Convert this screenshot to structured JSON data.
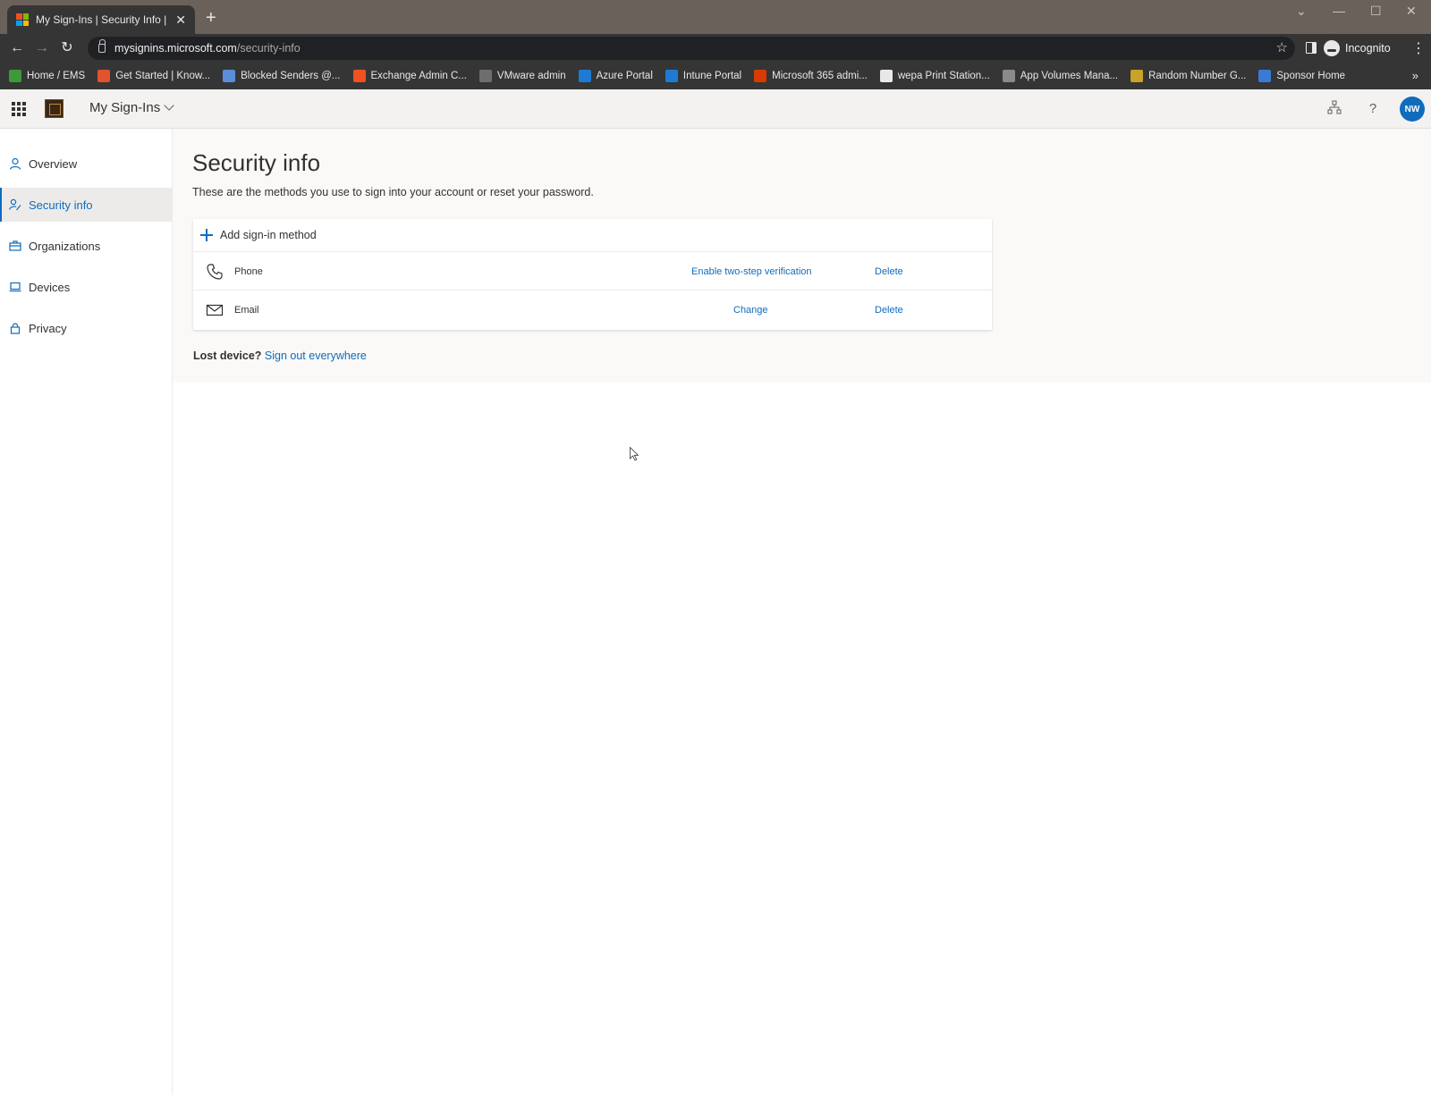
{
  "browser": {
    "tab_title": "My Sign-Ins | Security Info | Micr",
    "url_host": "mysignins.microsoft.com",
    "url_path": "/security-info",
    "profile_label": "Incognito",
    "bookmarks": [
      {
        "label": "Home / EMS",
        "color": "#3c9a3c"
      },
      {
        "label": "Get Started | Know...",
        "color": "#e0532e"
      },
      {
        "label": "Blocked Senders @...",
        "color": "#5b8dd8"
      },
      {
        "label": "Exchange Admin C...",
        "color": "#f25022"
      },
      {
        "label": "VMware admin",
        "color": "#6e6e6e"
      },
      {
        "label": "Azure Portal",
        "color": "#1e7bd3"
      },
      {
        "label": "Intune Portal",
        "color": "#1e7bd3"
      },
      {
        "label": "Microsoft 365 admi...",
        "color": "#d83b01"
      },
      {
        "label": "wepa Print Station...",
        "color": "#e8e8e8"
      },
      {
        "label": "App Volumes Mana...",
        "color": "#8a8a8a"
      },
      {
        "label": "Random Number G...",
        "color": "#c9a227"
      },
      {
        "label": "Sponsor Home",
        "color": "#3a7bd5"
      }
    ]
  },
  "header": {
    "app_title": "My Sign-Ins",
    "avatar_initials": "NW"
  },
  "nav": {
    "items": [
      {
        "label": "Overview",
        "icon": "person-icon",
        "active": false
      },
      {
        "label": "Security info",
        "icon": "person-key-icon",
        "active": true
      },
      {
        "label": "Organizations",
        "icon": "briefcase-icon",
        "active": false
      },
      {
        "label": "Devices",
        "icon": "laptop-icon",
        "active": false
      },
      {
        "label": "Privacy",
        "icon": "lock-icon",
        "active": false
      }
    ]
  },
  "main": {
    "title": "Security info",
    "subtitle": "These are the methods you use to sign into your account or reset your password.",
    "add_method_label": "Add sign-in method",
    "methods": [
      {
        "name": "Phone",
        "icon": "phone-icon",
        "action": "Enable two-step verification",
        "delete": "Delete"
      },
      {
        "name": "Email",
        "icon": "mail-icon",
        "action": "Change",
        "delete": "Delete"
      }
    ],
    "lost_device_label": "Lost device?",
    "sign_out_link": "Sign out everywhere"
  },
  "colors": {
    "accent": "#0f6cbd",
    "chrome_dark": "#353535",
    "title_bar": "#6b615b"
  }
}
